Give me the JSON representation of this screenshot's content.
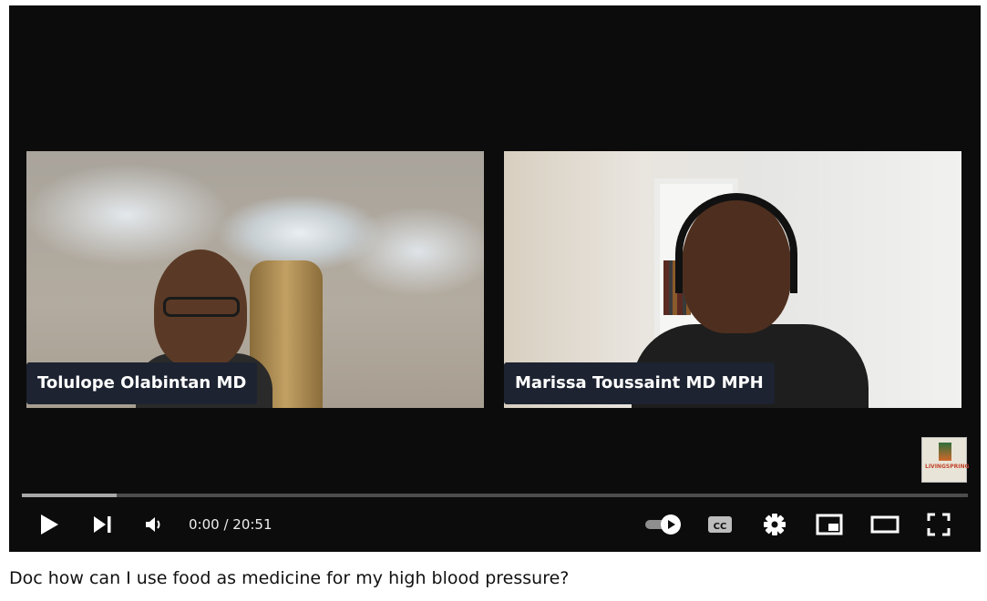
{
  "video": {
    "participants": [
      {
        "name": "Tolulope Olabintan MD"
      },
      {
        "name": "Marissa Toussaint MD MPH"
      }
    ],
    "logo_text": "LIVINGSPRING"
  },
  "player": {
    "current_time": "0:00",
    "duration": "20:51",
    "time_display": "0:00 / 20:51",
    "buffered_fraction": 0.1,
    "icons": [
      "play-icon",
      "next-icon",
      "volume-icon",
      "autoplay-toggle-icon",
      "captions-icon",
      "settings-icon",
      "miniplayer-icon",
      "theater-icon",
      "fullscreen-icon"
    ]
  },
  "title": "Doc how can I use food as medicine for my high blood pressure?"
}
